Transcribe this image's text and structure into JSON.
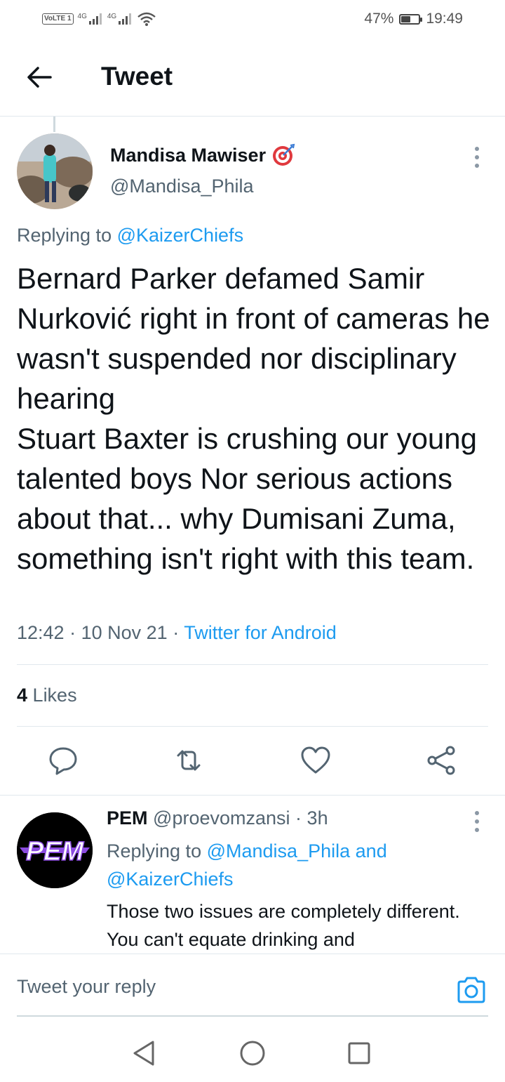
{
  "status_bar": {
    "volte_label": "VoLTE",
    "sim_label": "1",
    "signal1_label": "4G",
    "signal2_label": "4G",
    "battery_percent_text": "47%",
    "battery_level": 0.47,
    "time": "19:49"
  },
  "header": {
    "title": "Tweet"
  },
  "tweet": {
    "author_name": "Mandisa Mawiser",
    "author_handle": "@Mandisa_Phila",
    "replying_prefix": "Replying to",
    "replying_to": "@KaizerChiefs",
    "text": "Bernard Parker defamed Samir Nurković right in front of cameras he wasn't suspended nor disciplinary hearing\n Stuart Baxter is crushing our young talented boys Nor serious actions about that... why Dumisani Zuma, something isn't right with this team.",
    "time": "12:42",
    "date": "10 Nov 21",
    "source": "Twitter for Android",
    "likes_count": "4",
    "likes_label": "Likes"
  },
  "reply": {
    "avatar_text": "PEM",
    "author_name": "PEM",
    "author_handle": "@proevomzansi",
    "time_ago": "3h",
    "replying_prefix": "Replying to",
    "replying_to_1": "@Mandisa_Phila",
    "replying_and": "and",
    "replying_to_2": "@KaizerChiefs",
    "text": "Those two issues are completely different. You can't equate drinking and"
  },
  "composer": {
    "placeholder": "Tweet your reply"
  },
  "colors": {
    "accent": "#1d9bf0",
    "secondary_text": "#536471",
    "primary_text": "#0f1419",
    "divider": "#e1e8ed"
  },
  "icons": {
    "back": "arrow-left-icon",
    "more": "more-vertical-icon",
    "badge": "target-emoji-icon",
    "reply": "reply-icon",
    "retweet": "retweet-icon",
    "like": "heart-icon",
    "share": "share-icon",
    "camera": "camera-icon",
    "nav_back": "nav-back-icon",
    "nav_home": "nav-home-icon",
    "nav_recents": "nav-recents-icon"
  }
}
